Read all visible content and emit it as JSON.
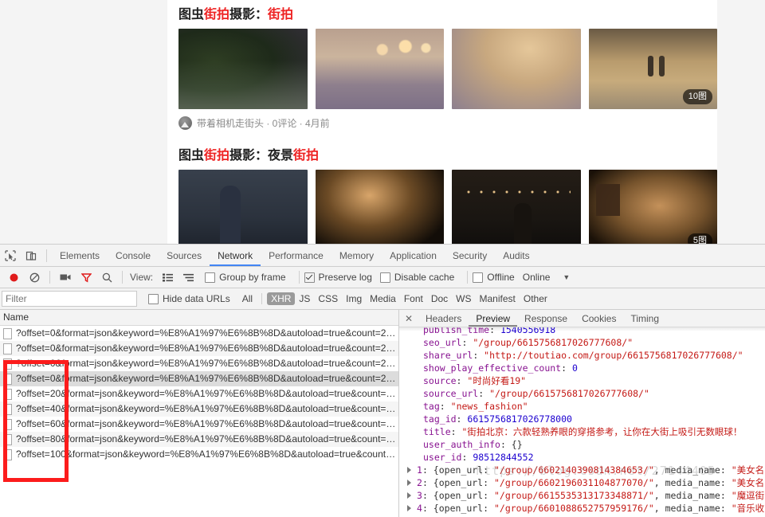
{
  "page": {
    "results": [
      {
        "title_parts": [
          {
            "t": "图虫",
            "hl": false
          },
          {
            "t": "街拍",
            "hl": true
          },
          {
            "t": "摄影：",
            "hl": false
          },
          {
            "t": "街拍",
            "hl": true
          }
        ],
        "thumbs": [
          {
            "badge": ""
          },
          {
            "badge": ""
          },
          {
            "badge": ""
          },
          {
            "badge": "10图"
          }
        ],
        "meta": "带着相机走街头 · 0评论 · 4月前"
      },
      {
        "title_parts": [
          {
            "t": "图虫",
            "hl": false
          },
          {
            "t": "街拍",
            "hl": true
          },
          {
            "t": "摄影：夜景",
            "hl": false
          },
          {
            "t": "街拍",
            "hl": true
          }
        ],
        "thumbs": [
          {
            "badge": ""
          },
          {
            "badge": ""
          },
          {
            "badge": ""
          },
          {
            "badge": "5图"
          }
        ],
        "meta": ""
      }
    ],
    "highlight_color": "#ee2222"
  },
  "devtools": {
    "tabs": [
      {
        "label": "Elements",
        "active": false
      },
      {
        "label": "Console",
        "active": false
      },
      {
        "label": "Sources",
        "active": false
      },
      {
        "label": "Network",
        "active": true
      },
      {
        "label": "Performance",
        "active": false
      },
      {
        "label": "Memory",
        "active": false
      },
      {
        "label": "Application",
        "active": false
      },
      {
        "label": "Security",
        "active": false
      },
      {
        "label": "Audits",
        "active": false
      }
    ],
    "toolbar": {
      "view_label": "View:",
      "group_by_frame": {
        "label": "Group by frame",
        "checked": false
      },
      "preserve_log": {
        "label": "Preserve log",
        "checked": true
      },
      "disable_cache": {
        "label": "Disable cache",
        "checked": false
      },
      "offline": {
        "label": "Offline",
        "checked": false
      },
      "throttling": "Online"
    },
    "filterbar": {
      "filter_placeholder": "Filter",
      "filter_value": "",
      "hide_data_urls": {
        "label": "Hide data URLs",
        "checked": false
      },
      "types": [
        {
          "label": "All",
          "selected": false
        },
        {
          "label": "XHR",
          "selected": true
        },
        {
          "label": "JS",
          "selected": false
        },
        {
          "label": "CSS",
          "selected": false
        },
        {
          "label": "Img",
          "selected": false
        },
        {
          "label": "Media",
          "selected": false
        },
        {
          "label": "Font",
          "selected": false
        },
        {
          "label": "Doc",
          "selected": false
        },
        {
          "label": "WS",
          "selected": false
        },
        {
          "label": "Manifest",
          "selected": false
        },
        {
          "label": "Other",
          "selected": false
        }
      ]
    },
    "network": {
      "column_name": "Name",
      "rows": [
        {
          "name": "?offset=0&format=json&keyword=%E8%A1%97%E6%8B%8D&autoload=true&count=2…",
          "selected": false
        },
        {
          "name": "?offset=0&format=json&keyword=%E8%A1%97%E6%8B%8D&autoload=true&count=2…",
          "selected": false
        },
        {
          "name": "?offset=0&format=json&keyword=%E8%A1%97%E6%8B%8D&autoload=true&count=2…",
          "selected": false
        },
        {
          "name": "?offset=0&format=json&keyword=%E8%A1%97%E6%8B%8D&autoload=true&count=2…",
          "selected": true
        },
        {
          "name": "?offset=20&format=json&keyword=%E8%A1%97%E6%8B%8D&autoload=true&count=…",
          "selected": false
        },
        {
          "name": "?offset=40&format=json&keyword=%E8%A1%97%E6%8B%8D&autoload=true&count=…",
          "selected": false
        },
        {
          "name": "?offset=60&format=json&keyword=%E8%A1%97%E6%8B%8D&autoload=true&count=…",
          "selected": false
        },
        {
          "name": "?offset=80&format=json&keyword=%E8%A1%97%E6%8B%8D&autoload=true&count=…",
          "selected": false
        },
        {
          "name": "?offset=100&format=json&keyword=%E8%A1%97%E6%8B%8D&autoload=true&count…",
          "selected": false
        }
      ]
    },
    "detail": {
      "tabs": [
        {
          "label": "Headers",
          "active": false
        },
        {
          "label": "Preview",
          "active": true
        },
        {
          "label": "Response",
          "active": false
        },
        {
          "label": "Cookies",
          "active": false
        },
        {
          "label": "Timing",
          "active": false
        }
      ],
      "close_label": "✕",
      "json_lines": [
        {
          "key": "publish_time",
          "val": "1540556918",
          "type": "n",
          "expandable": false,
          "clipped": true
        },
        {
          "key": "seo_url",
          "val": "\"/group/6615756817026777608/\"",
          "type": "s",
          "expandable": false
        },
        {
          "key": "share_url",
          "val": "\"http://toutiao.com/group/6615756817026777608/\"",
          "type": "s",
          "expandable": false
        },
        {
          "key": "show_play_effective_count",
          "val": "0",
          "type": "n",
          "expandable": false
        },
        {
          "key": "source",
          "val": "\"时尚好看19\"",
          "type": "s",
          "expandable": false
        },
        {
          "key": "source_url",
          "val": "\"/group/6615756817026777608/\"",
          "type": "s",
          "expandable": false
        },
        {
          "key": "tag",
          "val": "\"news_fashion\"",
          "type": "s",
          "expandable": false
        },
        {
          "key": "tag_id",
          "val": "6615756817026778000",
          "type": "n",
          "expandable": false
        },
        {
          "key": "title",
          "val": "\"街拍北京：六款轻熟养眼的穿搭参考，让你在大街上吸引无数眼球！",
          "type": "s",
          "expandable": false
        },
        {
          "key": "user_auth_info",
          "val": "{}",
          "type": "o",
          "expandable": false
        },
        {
          "key": "user_id",
          "val": "98512844552",
          "type": "n",
          "expandable": false
        }
      ],
      "array_lines": [
        {
          "index": "1",
          "open_url": "\"/group/6602140390814384653/\"",
          "media_name": "\"美女名"
        },
        {
          "index": "2",
          "open_url": "\"/group/6602196031104877070/\"",
          "media_name": "\"美女名"
        },
        {
          "index": "3",
          "open_url": "\"/group/6615535313173348871/\"",
          "media_name": "\"魔逗街"
        },
        {
          "index": "4",
          "open_url": "\"/group/6601088652757959176/\"",
          "media_name": "\"音乐收"
        }
      ],
      "array_prefix": "{open_url: ",
      "array_mid": ", media_name: ",
      "watermark": "https://blog.csdn.net/27144405"
    }
  },
  "annotation": {
    "box_color": "#fc1c1c"
  }
}
